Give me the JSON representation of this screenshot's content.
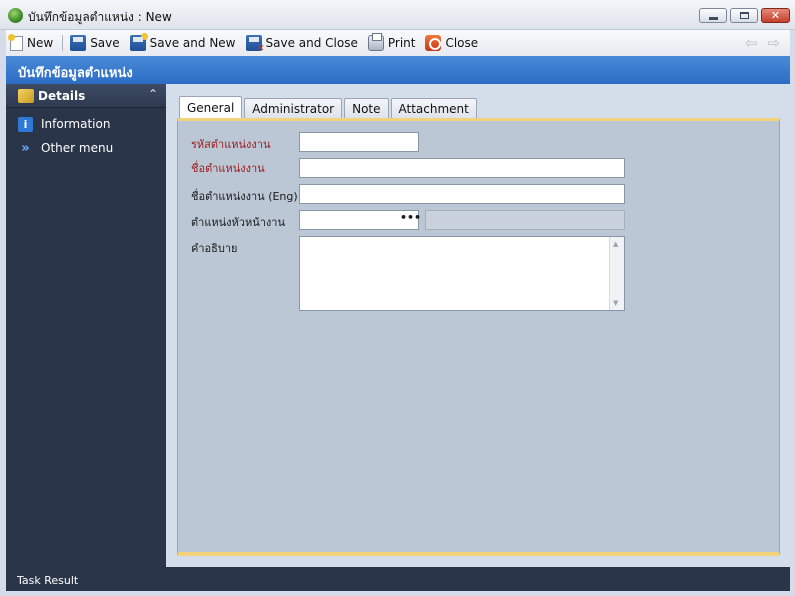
{
  "window": {
    "title": "บันทึกข้อมูลตำแหน่ง : New",
    "app_icon": "globe-recycle-icon"
  },
  "toolbar": {
    "new_label": "New",
    "save_label": "Save",
    "save_new_label": "Save and New",
    "save_close_label": "Save and Close",
    "print_label": "Print",
    "close_label": "Close",
    "prev_icon": "arrow-left-icon",
    "next_icon": "arrow-right-icon"
  },
  "header": {
    "title": "บันทึกข้อมูลตำแหน่ง"
  },
  "sidebar": {
    "section_label": "Details",
    "items": [
      {
        "label": "Information",
        "icon": "info-icon"
      },
      {
        "label": "Other menu",
        "icon": "chevrons-down-icon"
      }
    ]
  },
  "tabs": [
    {
      "label": "General",
      "active": true
    },
    {
      "label": "Administrator",
      "active": false
    },
    {
      "label": "Note",
      "active": false
    },
    {
      "label": "Attachment",
      "active": false
    }
  ],
  "form": {
    "position_code_label": "รหัสตำแหน่งงาน",
    "position_code_value": "",
    "position_name_label": "ชื่อตำแหน่งงาน",
    "position_name_value": "",
    "position_name_eng_label": "ชื่อตำแหน่งงาน (Eng)",
    "position_name_eng_value": "",
    "head_position_label": "ตำแหน่งหัวหน้างาน",
    "head_position_value": "",
    "head_position_desc": "",
    "lookup_label": "•••",
    "description_label": "คำอธิบาย",
    "description_value": ""
  },
  "status": {
    "label": "Task Result"
  },
  "colors": {
    "header_blue": "#2c6cc4",
    "sidebar_dark": "#2a3549",
    "panel_gray": "#bcc7d6",
    "required_label": "#9b1b1b",
    "accent_border": "#f2d27a"
  }
}
